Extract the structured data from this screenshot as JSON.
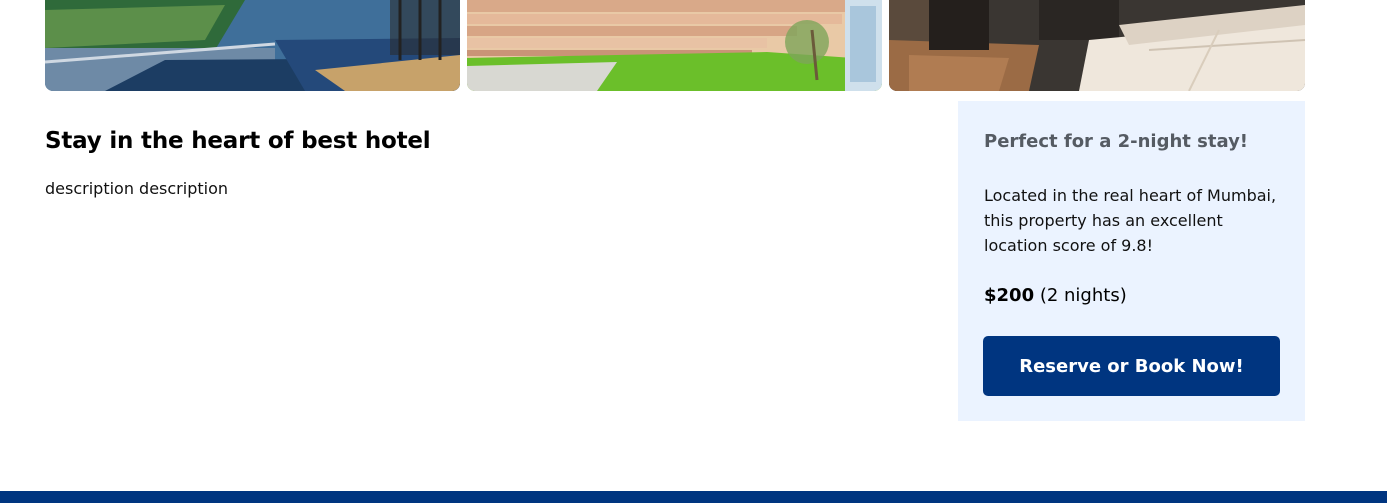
{
  "gallery": {
    "images": [
      {
        "alt": "balcony-view-photo"
      },
      {
        "alt": "garden-deck-photo"
      },
      {
        "alt": "hotel-room-photo"
      }
    ]
  },
  "main": {
    "title": "Stay in the heart of best hotel",
    "description": "description description"
  },
  "booking_card": {
    "heading": "Perfect for a 2-night stay!",
    "text": "Located in the real heart of Mumbai, this property has an excellent location score of 9.8!",
    "price_amount": "$200",
    "price_suffix": " (2 nights)",
    "button_label": "Reserve or Book Now!"
  },
  "colors": {
    "brand": "#003580",
    "card_bg": "#ebf3ff"
  }
}
